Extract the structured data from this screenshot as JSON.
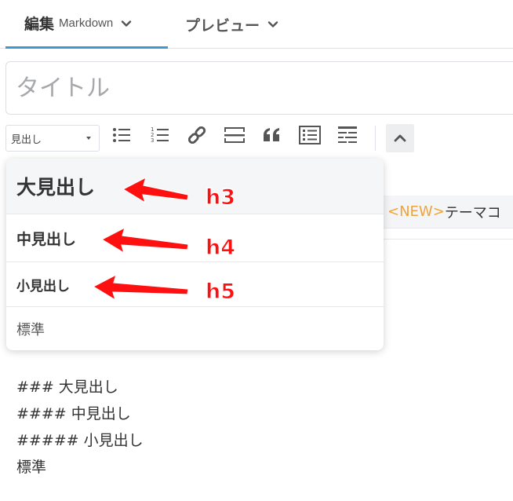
{
  "tabs": [
    {
      "label": "編集",
      "sublabel": "Markdown"
    },
    {
      "label": "プレビュー"
    }
  ],
  "title": {
    "placeholder": "タイトル",
    "value": ""
  },
  "toolbar": {
    "heading_select": "見出し",
    "buttons": [
      "bullet-list-icon",
      "numbered-list-icon",
      "link-icon",
      "horizontal-rule-icon",
      "quote-icon",
      "checklist-icon",
      "table-icon"
    ],
    "collapse_icon": "chevron-up-icon"
  },
  "heading_menu": {
    "options": [
      {
        "label": "大見出し",
        "tag": "h3"
      },
      {
        "label": "中見出し",
        "tag": "h4"
      },
      {
        "label": "小見出し",
        "tag": "h5"
      },
      {
        "label": "標準"
      }
    ]
  },
  "side_text": {
    "tag": "<NEW>",
    "text": "テーマコ"
  },
  "editor_lines": [
    "### 大見出し",
    "#### 中見出し",
    "##### 小見出し",
    "標準"
  ],
  "annotations": {
    "arrow_color": "#ff1010",
    "labels": [
      "h3",
      "h4",
      "h5"
    ]
  },
  "colors": {
    "accent": "#3d97d3",
    "new_tag": "#f0a33a"
  }
}
